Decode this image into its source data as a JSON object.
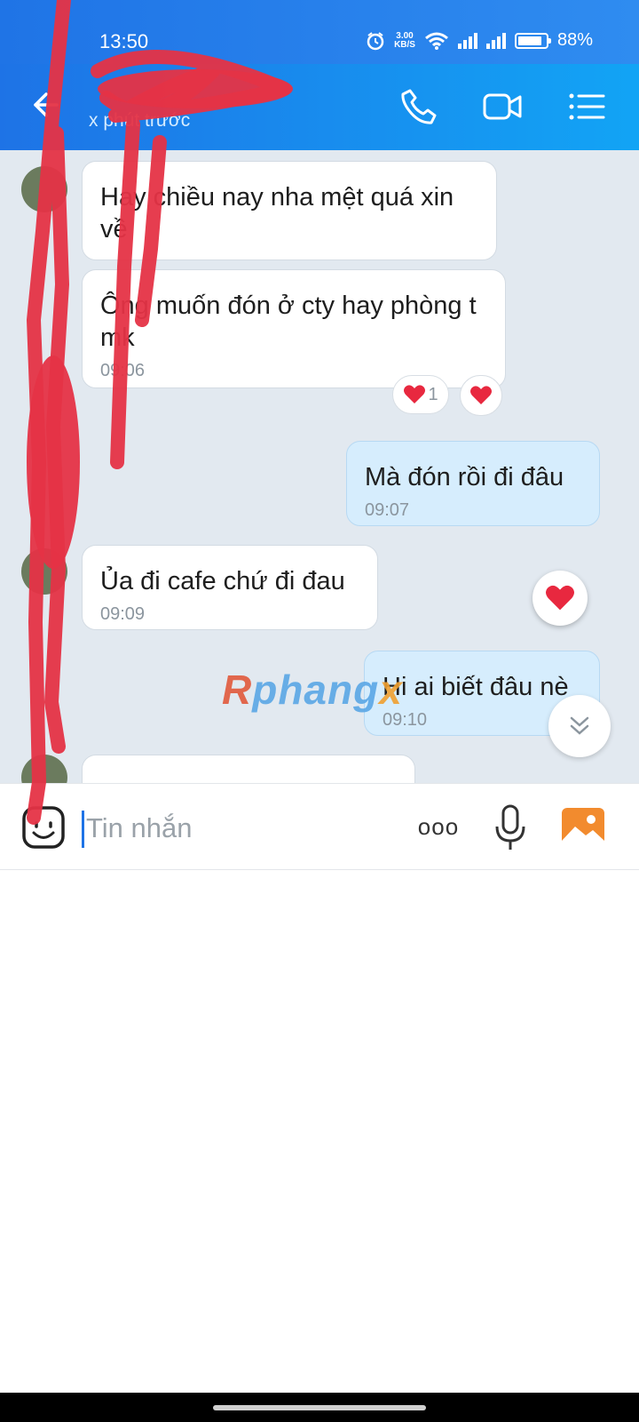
{
  "status_bar": {
    "time": "13:50",
    "speed_value": "3.00",
    "speed_unit": "KB/S",
    "battery": "88%",
    "battery_level": 0.88
  },
  "header": {
    "subtitle": "x phút trước",
    "icons": [
      "back-arrow-icon",
      "phone-icon",
      "video-call-icon",
      "menu-list-icon"
    ]
  },
  "messages": [
    {
      "from": "them",
      "text": "Hay chiều nay nha mệt quá xin về"
    },
    {
      "from": "them",
      "text": "Ông muốn đón ở cty hay phòng t mk",
      "time": "09:06",
      "reaction_count": "1"
    },
    {
      "from": "me",
      "text": "Mà đón rồi đi đâu",
      "time": "09:07"
    },
    {
      "from": "them",
      "text": "Ủa đi cafe chứ đi đau",
      "time": "09:09"
    },
    {
      "from": "me",
      "text": "Hi ai biết đâu nè",
      "time": "09:10"
    }
  ],
  "watermark": {
    "part1": "R",
    "part2": "phang",
    "part3": "x"
  },
  "composer": {
    "placeholder": "Tin nhắn",
    "more_label": "ooo"
  },
  "colors": {
    "header_start": "#1e73e6",
    "header_end": "#12a4f5",
    "chat_bg": "#e2e9f0",
    "my_bubble": "#d6edfd",
    "heart": "#e8283f",
    "gallery_icon": "#f28b2e"
  }
}
